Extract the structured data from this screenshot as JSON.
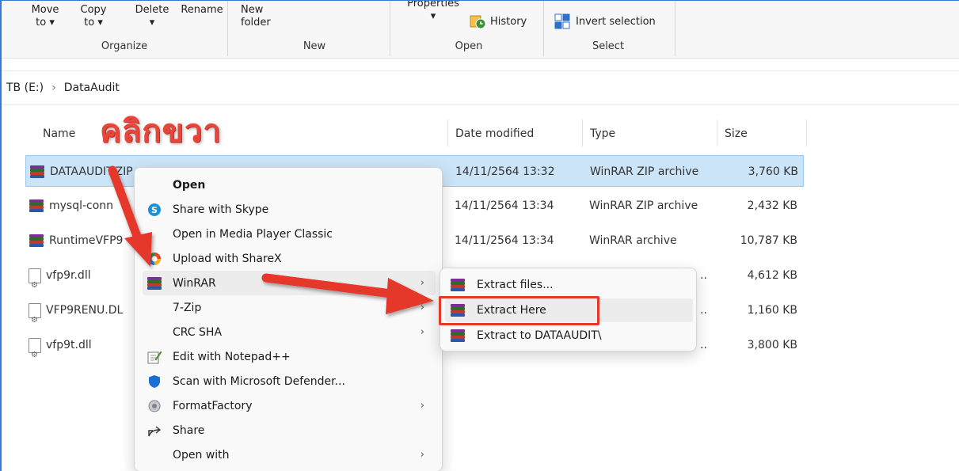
{
  "ribbon": {
    "organize": {
      "move_to": [
        "Move",
        "to ▾"
      ],
      "copy_to": [
        "Copy",
        "to ▾"
      ],
      "delete": "Delete",
      "rename": "Rename",
      "label": "Organize"
    },
    "new": {
      "new_folder": [
        "New",
        "folder"
      ],
      "label": "New"
    },
    "open": {
      "properties": "Properties",
      "history": "History",
      "label": "Open"
    },
    "select": {
      "invert": "Invert selection",
      "label": "Select"
    }
  },
  "address": {
    "drive": "TB (E:)",
    "separator": "›",
    "folder": "DataAudit"
  },
  "columns": {
    "name": "Name",
    "date": "Date modified",
    "type": "Type",
    "size": "Size"
  },
  "files": [
    {
      "name": "DATAAUDIT.ZIP",
      "date": "14/11/2564 13:32",
      "type": "WinRAR ZIP archive",
      "size": "3,760 KB",
      "icon": "winrar-icon"
    },
    {
      "name": "mysql-conn",
      "date": "14/11/2564 13:34",
      "type": "WinRAR ZIP archive",
      "size": "2,432 KB",
      "icon": "winrar-icon"
    },
    {
      "name": "RuntimeVFP9",
      "date": "14/11/2564 13:34",
      "type": "WinRAR archive",
      "size": "10,787 KB",
      "icon": "winrar-icon"
    },
    {
      "name": "vfp9r.dll",
      "date": "",
      "type": "..",
      "size": "4,612 KB",
      "icon": "dll-icon"
    },
    {
      "name": "VFP9RENU.DL",
      "date": "",
      "type": "..",
      "size": "1,160 KB",
      "icon": "dll-icon"
    },
    {
      "name": "vfp9t.dll",
      "date": "",
      "type": "..",
      "size": "3,800 KB",
      "icon": "dll-icon"
    }
  ],
  "context_menu": [
    {
      "label": "Open",
      "icon": "",
      "bold": true,
      "submenu": false
    },
    {
      "label": "Share with Skype",
      "icon": "skype-icon",
      "submenu": false
    },
    {
      "label": "Open in Media Player Classic",
      "icon": "",
      "submenu": false
    },
    {
      "label": "Upload with ShareX",
      "icon": "sharex-icon",
      "submenu": false
    },
    {
      "label": "WinRAR",
      "icon": "winrar-icon",
      "submenu": true,
      "active": true
    },
    {
      "label": "7-Zip",
      "icon": "",
      "submenu": true
    },
    {
      "label": "CRC SHA",
      "icon": "",
      "submenu": true
    },
    {
      "label": "Edit with Notepad++",
      "icon": "notepad-icon",
      "submenu": false
    },
    {
      "label": "Scan with Microsoft Defender...",
      "icon": "defender-icon",
      "submenu": false
    },
    {
      "label": "FormatFactory",
      "icon": "formatfactory-icon",
      "submenu": true
    },
    {
      "label": "Share",
      "icon": "share-icon",
      "submenu": false
    },
    {
      "label": "Open with",
      "icon": "",
      "submenu": true
    }
  ],
  "winrar_submenu": [
    {
      "label": "Extract files...",
      "icon": "winrar-icon"
    },
    {
      "label": "Extract Here",
      "icon": "winrar-icon",
      "highlighted": true
    },
    {
      "label": "Extract to DATAAUDIT\\",
      "icon": "winrar-icon"
    }
  ],
  "annotation": {
    "text": "คลิกขวา"
  },
  "colors": {
    "selection": "#cce4f7",
    "annotation_red": "#e5382a",
    "accent_blue": "#3a78d6",
    "winrar_stripes": [
      "#7b2f8e",
      "#2d6c2a",
      "#c03a2b",
      "#2e56a7"
    ]
  }
}
